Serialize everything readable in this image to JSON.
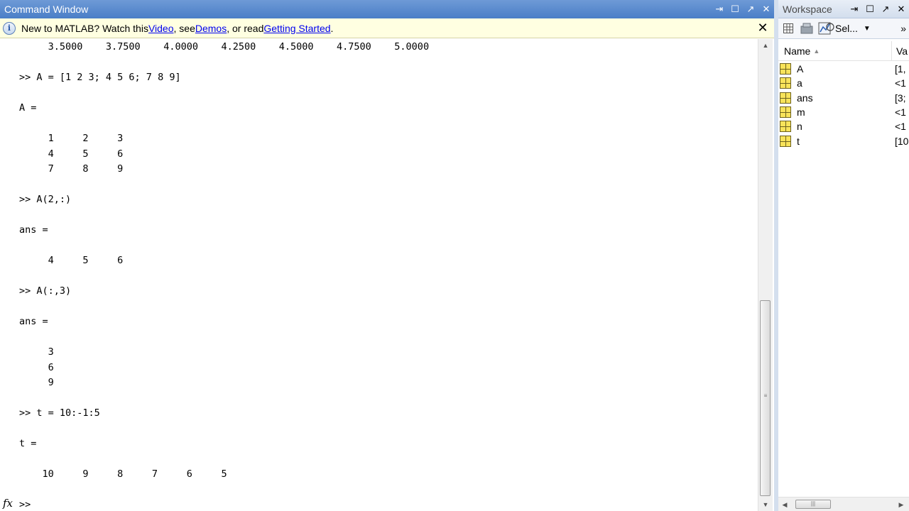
{
  "command_window": {
    "title": "Command Window",
    "notice": {
      "prefix": "New to MATLAB? Watch this ",
      "link_video": "Video",
      "mid1": ", see ",
      "link_demos": "Demos",
      "mid2": ", or read ",
      "link_getting_started": "Getting Started",
      "suffix": "."
    },
    "output_lines": [
      "     3.5000    3.7500    4.0000    4.2500    4.5000    4.7500    5.0000",
      "",
      ">> A = [1 2 3; 4 5 6; 7 8 9]",
      "",
      "A =",
      "",
      "     1     2     3",
      "     4     5     6",
      "     7     8     9",
      "",
      ">> A(2,:)",
      "",
      "ans =",
      "",
      "     4     5     6",
      "",
      ">> A(:,3)",
      "",
      "ans =",
      "",
      "     3",
      "     6",
      "     9",
      "",
      ">> t = 10:-1:5",
      "",
      "t =",
      "",
      "    10     9     8     7     6     5",
      "",
      ">> "
    ],
    "fx_label": "fx"
  },
  "workspace": {
    "title": "Workspace",
    "toolbar": {
      "select_label": "Sel..."
    },
    "columns": {
      "name": "Name",
      "value": "Va"
    },
    "variables": [
      {
        "name": "A",
        "value": "[1,"
      },
      {
        "name": "a",
        "value": "<1"
      },
      {
        "name": "ans",
        "value": "[3;"
      },
      {
        "name": "m",
        "value": "<1"
      },
      {
        "name": "n",
        "value": "<1"
      },
      {
        "name": "t",
        "value": "[10"
      }
    ]
  },
  "colors": {
    "title_bar_active": "#4a7ec7",
    "notice_background": "#ffffe1",
    "link": "#0000ee",
    "variable_icon": "#f8e35a"
  },
  "icons": [
    "info-icon",
    "undock-icon",
    "maximize-icon",
    "minimize-icon",
    "close-icon",
    "fx-icon",
    "new-variable-icon",
    "import-data-icon",
    "plot-selection-icon",
    "variable-icon"
  ]
}
